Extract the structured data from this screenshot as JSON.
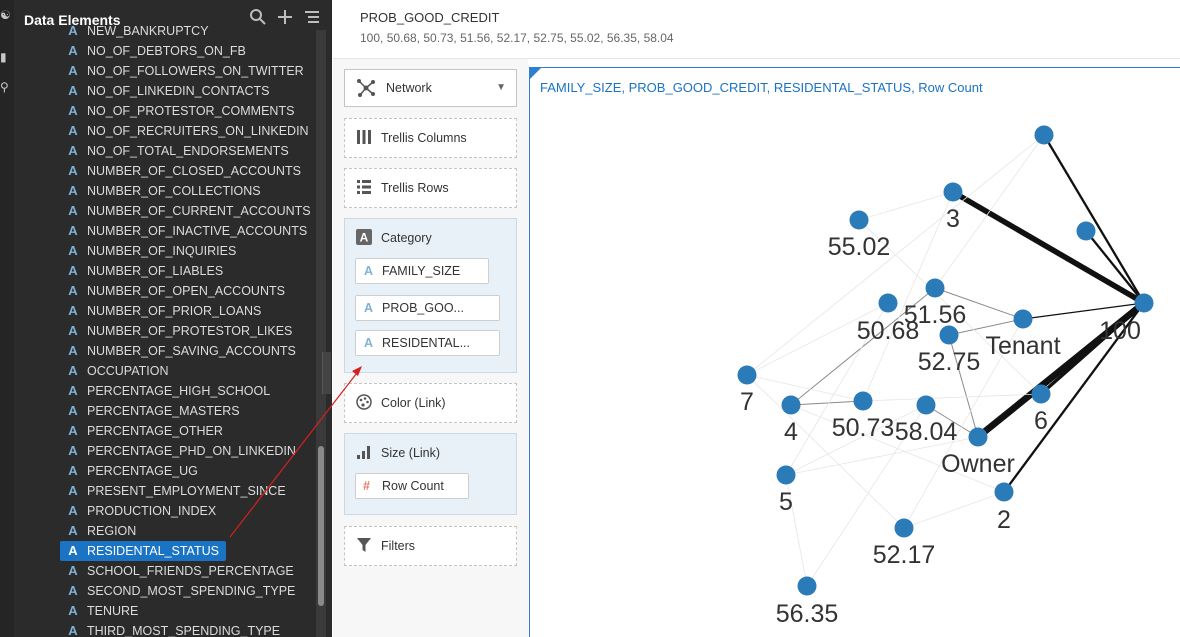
{
  "left_panel": {
    "title": "Data Elements",
    "icons": [
      "search-icon",
      "plus-icon",
      "list-menu-icon"
    ],
    "items": [
      "NEW_BANKRUPTCY",
      "NO_OF_DEBTORS_ON_FB",
      "NO_OF_FOLLOWERS_ON_TWITTER",
      "NO_OF_LINKEDIN_CONTACTS",
      "NO_OF_PROTESTOR_COMMENTS",
      "NO_OF_RECRUITERS_ON_LINKEDIN",
      "NO_OF_TOTAL_ENDORSEMENTS",
      "NUMBER_OF_CLOSED_ACCOUNTS",
      "NUMBER_OF_COLLECTIONS",
      "NUMBER_OF_CURRENT_ACCOUNTS",
      "NUMBER_OF_INACTIVE_ACCOUNTS",
      "NUMBER_OF_INQUIRIES",
      "NUMBER_OF_LIABLES",
      "NUMBER_OF_OPEN_ACCOUNTS",
      "NUMBER_OF_PRIOR_LOANS",
      "NUMBER_OF_PROTESTOR_LIKES",
      "NUMBER_OF_SAVING_ACCOUNTS",
      "OCCUPATION",
      "PERCENTAGE_HIGH_SCHOOL",
      "PERCENTAGE_MASTERS",
      "PERCENTAGE_OTHER",
      "PERCENTAGE_PHD_ON_LINKEDIN",
      "PERCENTAGE_UG",
      "PRESENT_EMPLOYMENT_SINCE",
      "PRODUCTION_INDEX",
      "REGION",
      "RESIDENTAL_STATUS",
      "SCHOOL_FRIENDS_PERCENTAGE",
      "SECOND_MOST_SPENDING_TYPE",
      "TENURE",
      "THIRD_MOST_SPENDING_TYPE"
    ],
    "selected": "RESIDENTAL_STATUS",
    "type_glyph": "A"
  },
  "top_info": {
    "title": "PROB_GOOD_CREDIT",
    "values": "100, 50.68, 50.73, 51.56, 52.17, 52.75, 55.02, 56.35, 58.04"
  },
  "grammar": {
    "chart_type": "Network",
    "trellis_columns": "Trellis Columns",
    "trellis_rows": "Trellis Rows",
    "category_label": "Category",
    "category_items": [
      "FAMILY_SIZE",
      "PROB_GOO...",
      "RESIDENTAL..."
    ],
    "color_label": "Color (Link)",
    "size_label": "Size (Link)",
    "size_item": "Row Count",
    "filters_label": "Filters"
  },
  "viz": {
    "title": "FAMILY_SIZE, PROB_GOOD_CREDIT, RESIDENTAL_STATUS, Row Count",
    "node_color": "#2b7bb9",
    "link_color": "#111111",
    "nodes": [
      {
        "id": "n100",
        "label": "100"
      },
      {
        "id": "tenant",
        "label": "Tenant"
      },
      {
        "id": "owner",
        "label": "Owner"
      },
      {
        "id": "n3",
        "label": "3"
      },
      {
        "id": "n6",
        "label": "6"
      },
      {
        "id": "n2",
        "label": "2"
      },
      {
        "id": "n7",
        "label": "7"
      },
      {
        "id": "n4",
        "label": "4"
      },
      {
        "id": "n5",
        "label": "5"
      },
      {
        "id": "p5502",
        "label": "55.02"
      },
      {
        "id": "p5156",
        "label": "51.56"
      },
      {
        "id": "p5068",
        "label": "50.68"
      },
      {
        "id": "p5275",
        "label": "52.75"
      },
      {
        "id": "p5073",
        "label": "50.73"
      },
      {
        "id": "p5804",
        "label": "58.04"
      },
      {
        "id": "p5217",
        "label": "52.17"
      },
      {
        "id": "p5635",
        "label": "56.35"
      },
      {
        "id": "top1",
        "label": ""
      },
      {
        "id": "top2",
        "label": ""
      }
    ],
    "links": [
      {
        "source": "n100",
        "target": "top1",
        "rows": 2
      },
      {
        "source": "n100",
        "target": "n3",
        "rows": 5
      },
      {
        "source": "n100",
        "target": "top2",
        "rows": 2
      },
      {
        "source": "n100",
        "target": "tenant",
        "rows": 1
      },
      {
        "source": "n100",
        "target": "n6",
        "rows": 3
      },
      {
        "source": "n100",
        "target": "owner",
        "rows": 6
      },
      {
        "source": "n100",
        "target": "n2",
        "rows": 2
      },
      {
        "source": "tenant",
        "target": "p5156",
        "rows": 1
      },
      {
        "source": "tenant",
        "target": "p5275",
        "rows": 1
      },
      {
        "source": "owner",
        "target": "p5275",
        "rows": 1
      },
      {
        "source": "owner",
        "target": "p5804",
        "rows": 1
      },
      {
        "source": "n4",
        "target": "p5156",
        "rows": 1
      },
      {
        "source": "n4",
        "target": "p5073",
        "rows": 1
      },
      {
        "source": "n7",
        "target": "p5068",
        "rows": 0
      },
      {
        "source": "n7",
        "target": "p5073",
        "rows": 0
      },
      {
        "source": "n7",
        "target": "p5217",
        "rows": 0
      },
      {
        "source": "n5",
        "target": "p5635",
        "rows": 0
      },
      {
        "source": "n5",
        "target": "p5068",
        "rows": 0
      },
      {
        "source": "n5",
        "target": "p5804",
        "rows": 0
      },
      {
        "source": "n3",
        "target": "p5073",
        "rows": 0
      },
      {
        "source": "n3",
        "target": "p5502",
        "rows": 0
      },
      {
        "source": "p5502",
        "target": "n6",
        "rows": 0
      },
      {
        "source": "p5217",
        "target": "n2",
        "rows": 0
      },
      {
        "source": "p5217",
        "target": "tenant",
        "rows": 0
      },
      {
        "source": "p5635",
        "target": "p5804",
        "rows": 0
      },
      {
        "source": "top1",
        "target": "p5156",
        "rows": 0
      },
      {
        "source": "top1",
        "target": "n7",
        "rows": 0
      },
      {
        "source": "owner",
        "target": "n5",
        "rows": 0
      },
      {
        "source": "n6",
        "target": "p5073",
        "rows": 0
      },
      {
        "source": "n2",
        "target": "n4",
        "rows": 0
      }
    ]
  }
}
